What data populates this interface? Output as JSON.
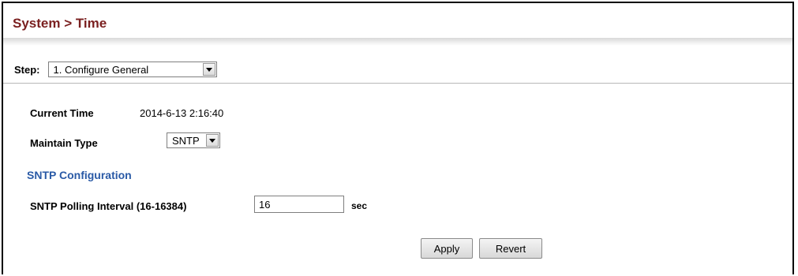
{
  "header": {
    "title": "System > Time"
  },
  "step": {
    "label": "Step:",
    "selected": "1. Configure General"
  },
  "general": {
    "current_time_label": "Current Time",
    "current_time_value": "2014-6-13 2:16:40",
    "maintain_type_label": "Maintain Type",
    "maintain_type_value": "SNTP"
  },
  "sntp": {
    "heading": "SNTP Configuration",
    "polling_label": "SNTP Polling Interval (16-16384)",
    "polling_value": "16",
    "polling_unit": "sec"
  },
  "actions": {
    "apply_label": "Apply",
    "revert_label": "Revert"
  },
  "colors": {
    "title": "#7a1f1f",
    "sub_heading": "#2a5aa6"
  }
}
